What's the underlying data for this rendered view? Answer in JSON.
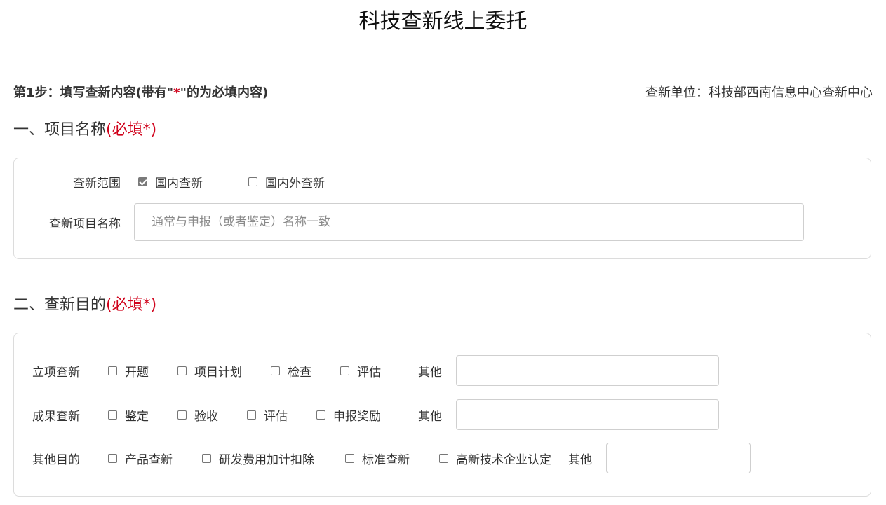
{
  "page": {
    "title": "科技查新线上委托"
  },
  "step": {
    "prefix": "第1步：填写查新内容(带有\"",
    "star": "*",
    "suffix": "\"的为必填内容)",
    "unit": "查新单位：科技部西南信息中心查新中心"
  },
  "section1": {
    "title": "一、项目名称",
    "required": "(必填*)",
    "scope_label": "查新范围",
    "scope_options": [
      {
        "label": "国内查新",
        "checked": true
      },
      {
        "label": "国内外查新",
        "checked": false
      }
    ],
    "name_label": "查新项目名称",
    "name_placeholder": "通常与申报（或者鉴定）名称一致",
    "name_value": ""
  },
  "section2": {
    "title": "二、查新目的",
    "required": "(必填*)",
    "rows": [
      {
        "label": "立项查新",
        "options": [
          "开题",
          "项目计划",
          "检查",
          "评估"
        ],
        "other_label": "其他",
        "other_value": ""
      },
      {
        "label": "成果查新",
        "options": [
          "鉴定",
          "验收",
          "评估",
          "申报奖励"
        ],
        "other_label": "其他",
        "other_value": ""
      },
      {
        "label": "其他目的",
        "options": [
          "产品查新",
          "研发费用加计扣除",
          "标准查新",
          "高新技术企业认定"
        ],
        "other_label": "其他",
        "other_value": ""
      }
    ]
  },
  "colors": {
    "required": "#d0021b",
    "border": "#dcdcdc",
    "text": "#333333"
  }
}
